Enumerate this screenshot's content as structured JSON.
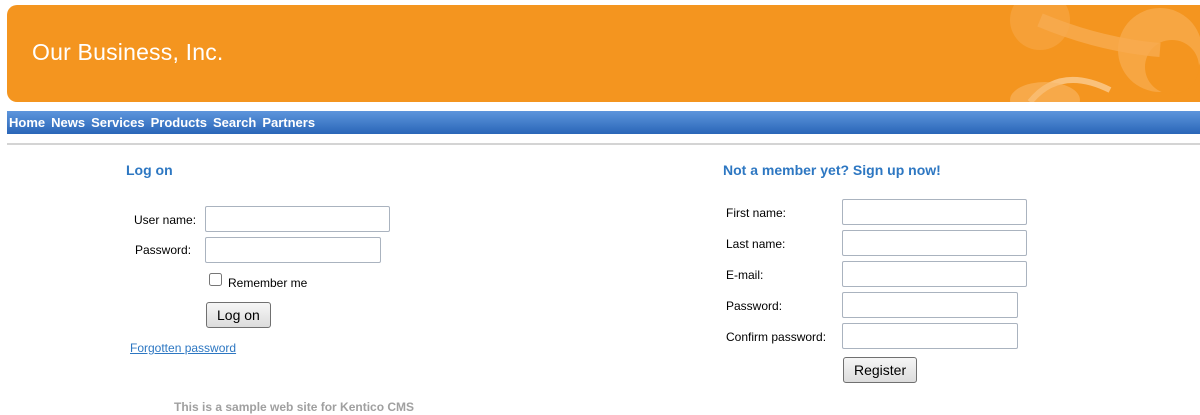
{
  "header": {
    "title": "Our Business, Inc."
  },
  "nav": {
    "items": [
      {
        "label": "Home"
      },
      {
        "label": "News"
      },
      {
        "label": "Services"
      },
      {
        "label": "Products"
      },
      {
        "label": "Search"
      },
      {
        "label": "Partners"
      }
    ]
  },
  "logon": {
    "title": "Log on",
    "username_label": "User name:",
    "username_value": "",
    "password_label": "Password:",
    "password_value": "",
    "remember_label": "Remember me",
    "remember_checked": false,
    "button_label": "Log on",
    "forgot_label": "Forgotten password"
  },
  "signup": {
    "title": "Not a member yet? Sign up now!",
    "first_name_label": "First name:",
    "last_name_label": "Last name:",
    "email_label": "E-mail:",
    "password_label": "Password:",
    "confirm_label": "Confirm password:",
    "button_label": "Register"
  },
  "footer": {
    "text": "This is a sample web site for Kentico CMS"
  },
  "colors": {
    "header_bg": "#f4951f",
    "nav_bg": "#3a79c9",
    "accent": "#2d77c2"
  }
}
